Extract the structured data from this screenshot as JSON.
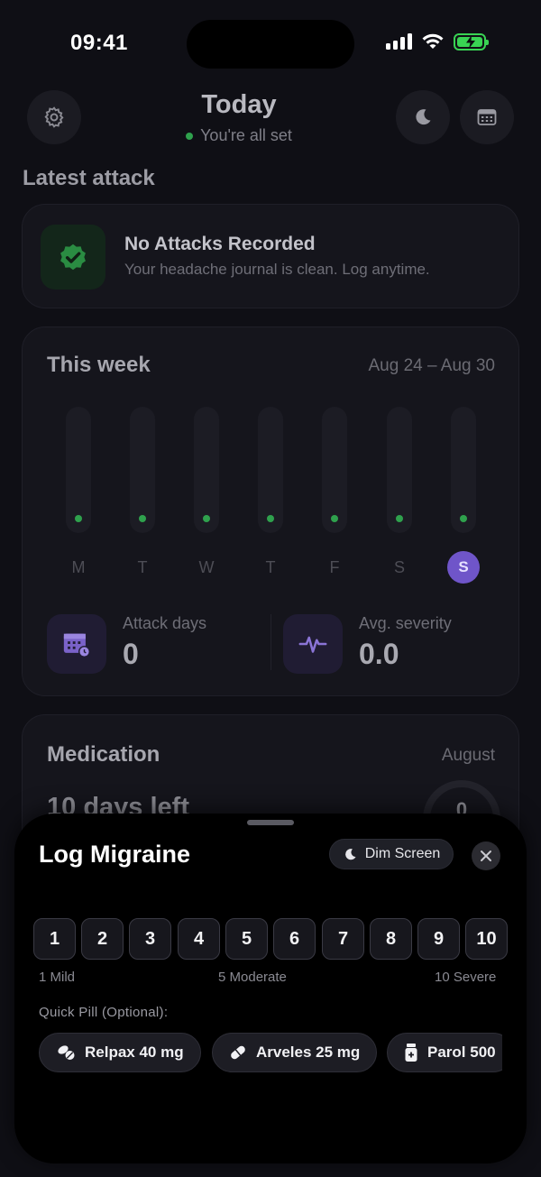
{
  "status_bar": {
    "time": "09:41"
  },
  "header": {
    "title": "Today",
    "subtitle": "You're all set",
    "status_color": "#2fa14d"
  },
  "latest_attack": {
    "section_title": "Latest attack",
    "title": "No Attacks Recorded",
    "subtitle": "Your headache journal is clean. Log anytime."
  },
  "week": {
    "title": "This week",
    "range": "Aug 24 – Aug 30",
    "days": [
      "M",
      "T",
      "W",
      "T",
      "F",
      "S",
      "S"
    ],
    "active_day_index": 6,
    "stats": {
      "attack_days_label": "Attack days",
      "attack_days_value": "0",
      "avg_severity_label": "Avg. severity",
      "avg_severity_value": "0.0"
    }
  },
  "medication": {
    "title": "Medication",
    "month": "August",
    "days_left": "10 days left",
    "ring_value": "0"
  },
  "sheet": {
    "title": "Log Migraine",
    "dim_label": "Dim Screen",
    "severity_options": [
      "1",
      "2",
      "3",
      "4",
      "5",
      "6",
      "7",
      "8",
      "9",
      "10"
    ],
    "scale_labels": {
      "low": "1 Mild",
      "mid": "5 Moderate",
      "high": "10 Severe"
    },
    "quick_pill_label": "Quick Pill (Optional):",
    "pills": [
      {
        "label": "Relpax 40 mg",
        "icon": "pills-icon"
      },
      {
        "label": "Arveles 25 mg",
        "icon": "capsule-icon"
      },
      {
        "label": "Parol 500",
        "icon": "bottle-icon"
      }
    ]
  },
  "colors": {
    "accent_purple": "#6f55c9",
    "success_green": "#2fa14d",
    "battery_green": "#39d353"
  }
}
